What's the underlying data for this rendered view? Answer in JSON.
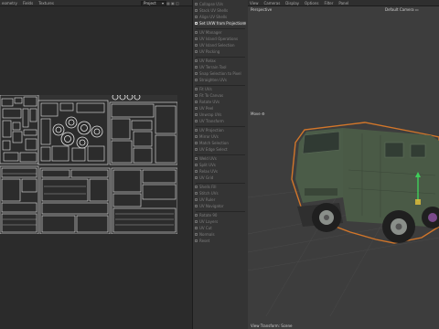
{
  "uv_editor": {
    "menu": [
      "Geometry",
      "Fields",
      "Textures"
    ],
    "menu_visible": [
      "eometry",
      "Fields",
      "Textures"
    ],
    "view_dropdown": "Project"
  },
  "tools": {
    "items": [
      "Collapse UVs",
      "Stack UV Shells",
      "Align UV Shells",
      "Set UVW from Projection",
      "UV Manager",
      "UV Island Operations",
      "UV Island Selection",
      "UV Packing",
      "UV Relax",
      "UV Terrain Tool",
      "Snap Selection to Pixel",
      "Straighten UVs",
      "Fit UVs",
      "Fit To Canvas",
      "Rotate UVs",
      "UV Peel",
      "Unwrap UVs",
      "UV Transform",
      "UV Projection",
      "Mirror UVs",
      "Match Selection",
      "UV Edge Select",
      "Weld UVs",
      "Split UVs",
      "Relax UVs",
      "UV Grid",
      "Shells Fill",
      "Stitch UVs",
      "UV Ruler",
      "UV Navigator",
      "Rotate 90",
      "UV Layers",
      "UV Cut",
      "Normals",
      "Reset"
    ],
    "active_index": 3,
    "colors": {
      "active_bg": "#3f3f3f",
      "panel_bg": "#343434"
    }
  },
  "viewport": {
    "menu": [
      "View",
      "Cameras",
      "Display",
      "Options",
      "Filter",
      "Panel"
    ],
    "view_label": "Perspective",
    "camera_label": "Default Camera",
    "move_label": "Move",
    "status_text": "View Transform: Scene",
    "colors": {
      "selection_outline": "#d2762a",
      "truck_body": "#4a5a46",
      "axis_y": "#3fcf5a"
    }
  }
}
